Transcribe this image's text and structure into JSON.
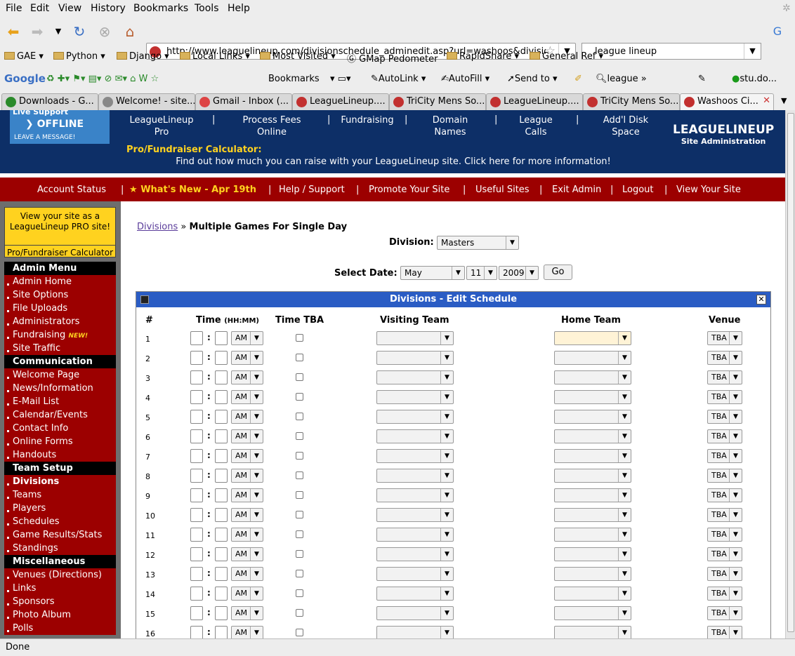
{
  "browser": {
    "menu": [
      "File",
      "Edit",
      "View",
      "History",
      "Bookmarks",
      "Tools",
      "Help"
    ],
    "url": "http://www.leaguelineup.com/divisionschedule_adminedit.asp?url=washoos&divisio",
    "search": "league lineup",
    "bookmarks": [
      "GAE",
      "Python",
      "Django",
      "Local Links",
      "Most Visited",
      "GMap Pedometer",
      "RapidShare",
      "General Ref"
    ],
    "toolbar": {
      "google": "Google",
      "bookmarks": "Bookmarks",
      "autolink": "AutoLink",
      "autofill": "AutoFill",
      "sendto": "Send to",
      "search": "league",
      "user": "stu.do..."
    },
    "tabs": [
      "Downloads - G...",
      "Welcome! - site...",
      "Gmail - Inbox (...",
      "LeagueLineup....",
      "TriCity Mens So...",
      "LeagueLineup....",
      "TriCity Mens So...",
      "Washoos Ci..."
    ],
    "status": "Done"
  },
  "site": {
    "live_support": {
      "l1": "Live Support",
      "l2": "OFFLINE",
      "l3": "LEAVE A MESSAGE!"
    },
    "top_links": [
      "LeagueLineup Pro",
      "Process Fees Online",
      "Fundraising",
      "Domain Names",
      "League Calls",
      "Add'l Disk Space"
    ],
    "logo": {
      "big": "LEAGUELINEUP",
      "small": "Site Administration"
    },
    "calc_label": "Pro/Fundraiser Calculator:",
    "calc_text": "Find out how much you can raise with your LeagueLineup site.  Click here for more information!",
    "red_links": [
      "Account Status",
      "What's New - Apr 19th",
      "Help / Support",
      "Promote Your Site",
      "Useful Sites",
      "Exit Admin",
      "Logout",
      "View Your Site"
    ]
  },
  "sidebar": {
    "pro_text": "View your site as a LeagueLineup PRO site!",
    "pro_calc": "Pro/Fundraiser Calculator",
    "sections": [
      {
        "title": "Admin Menu",
        "items": [
          "Admin Home",
          "Site Options",
          "File Uploads",
          "Administrators",
          "Fundraising",
          "Site Traffic"
        ]
      },
      {
        "title": "Communication",
        "items": [
          "Welcome Page",
          "News/Information",
          "E-Mail List",
          "Calendar/Events",
          "Contact Info",
          "Online Forms",
          "Handouts"
        ]
      },
      {
        "title": "Team Setup",
        "items": [
          "Divisions",
          "Teams",
          "Players",
          "Schedules",
          "Game Results/Stats",
          "Standings"
        ]
      },
      {
        "title": "Miscellaneous",
        "items": [
          "Venues (Directions)",
          "Links",
          "Sponsors",
          "Photo Album",
          "Polls"
        ]
      }
    ],
    "new_tag": "NEW!"
  },
  "page": {
    "breadcrumb_link": "Divisions",
    "breadcrumb_sep": "»",
    "breadcrumb_current": "Multiple Games For Single Day",
    "division_label": "Division:",
    "division_value": "Masters",
    "date_label": "Select Date:",
    "month": "May",
    "day": "11",
    "year": "2009",
    "go": "Go",
    "panel_title": "Divisions - Edit Schedule",
    "columns": {
      "num": "#",
      "time": "Time",
      "time_fmt": "(HH:MM)",
      "tba": "Time TBA",
      "visiting": "Visiting Team",
      "home": "Home Team",
      "venue": "Venue"
    },
    "row_numbers": [
      "1",
      "2",
      "3",
      "4",
      "5",
      "6",
      "7",
      "8",
      "9",
      "10",
      "11",
      "12",
      "13",
      "14",
      "15",
      "16"
    ],
    "ampm_default": "AM",
    "venue_default": "TBA"
  }
}
